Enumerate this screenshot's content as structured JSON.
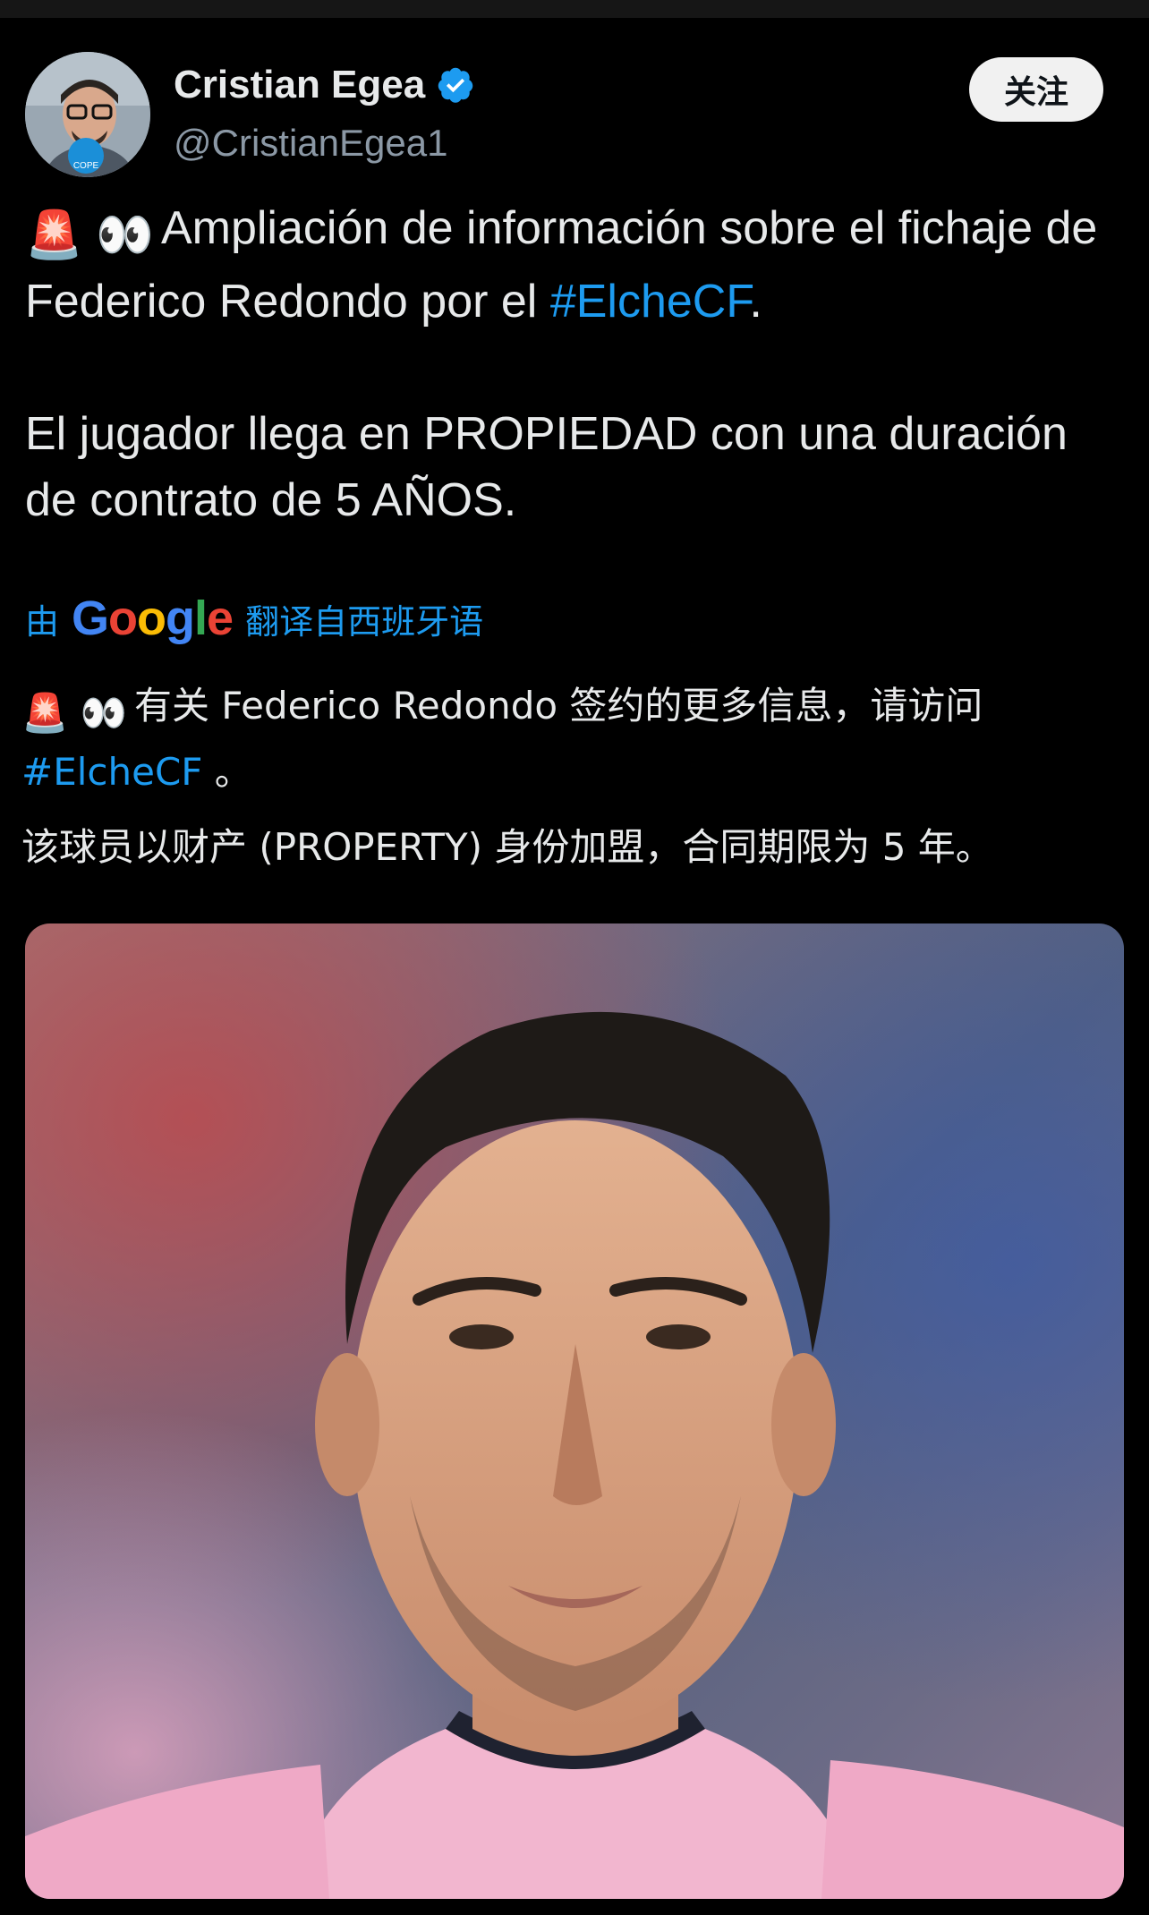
{
  "author": {
    "name": "Cristian Egea",
    "handle": "@CristianEgea1",
    "avatar_badge": "COPE",
    "verified_icon": "verified-badge-icon"
  },
  "actions": {
    "follow_label": "关注"
  },
  "tweet": {
    "p1_emoji": "🚨 👀",
    "p1_text": "Ampliación de información sobre el fichaje de Federico Redondo por el ",
    "p1_hashtag": "#ElcheCF",
    "p1_end": ".",
    "p2_text": "El jugador llega en PROPIEDAD con una duración de contrato de 5 AÑOS."
  },
  "translation": {
    "prefix": "由",
    "google": "Google",
    "suffix": "翻译自西班牙语",
    "t1_emoji": "🚨 👀",
    "t1_text": "有关 Federico Redondo 签约的更多信息，请访问",
    "t1_hashtag": "#ElcheCF",
    "t1_end": " 。",
    "t2_text": "该球员以财产 (PROPERTY) 身份加盟，合同期限为 5 年。"
  },
  "media": {
    "type": "photo",
    "subject": "player-portrait"
  },
  "colors": {
    "background": "#000000",
    "text": "#e7e9ea",
    "link": "#1d9bf0",
    "handle": "#8b98a5",
    "follow_button": "#f1f1f1"
  }
}
